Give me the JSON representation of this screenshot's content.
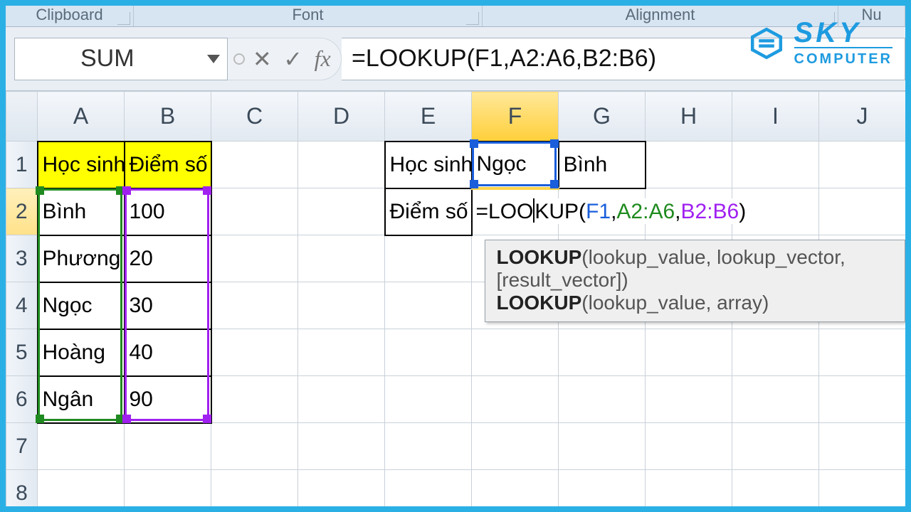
{
  "ribbon": {
    "groups": {
      "clipboard": "Clipboard",
      "font": "Font",
      "alignment": "Alignment",
      "number": "Nu"
    }
  },
  "name_box": "SUM",
  "fx": {
    "cancel": "✕",
    "enter": "✓",
    "label": "fx"
  },
  "formula_bar": "=LOOKUP(F1,A2:A6,B2:B6)",
  "columns": [
    "A",
    "B",
    "C",
    "D",
    "E",
    "F",
    "G",
    "H",
    "I",
    "J"
  ],
  "rows": [
    "1",
    "2",
    "3",
    "4",
    "5",
    "6",
    "7",
    "8"
  ],
  "selected_column_index": 5,
  "cells": {
    "A1": "Học sinh",
    "B1": "Điểm số",
    "A2": "Bình",
    "B2": "100",
    "A3": "Phương",
    "B3": "20",
    "A4": "Ngọc",
    "B4": "30",
    "A5": "Hoàng",
    "B5": "40",
    "A6": "Ngân",
    "B6": "90",
    "E1": "Học sinh",
    "F1": "Ngọc",
    "G1": "Bình",
    "E2": "Điểm số"
  },
  "editing": {
    "cell": "F2",
    "prefix": "=LOO",
    "mid": "KUP(",
    "ref1": "F1",
    "ref2": "A2:A6",
    "ref3": "B2:B6",
    "suffix": ")"
  },
  "tooltip": {
    "fn": "LOOKUP",
    "sig1": "(lookup_value, lookup_vector, [result_vector])",
    "sig2": "(lookup_value, array)"
  },
  "ranges": {
    "green": {
      "ref": "A2:A6"
    },
    "purple": {
      "ref": "B2:B6"
    },
    "blue": {
      "ref": "F1"
    }
  },
  "logo": {
    "line1": "SKY",
    "line2": "COMPUTER"
  }
}
